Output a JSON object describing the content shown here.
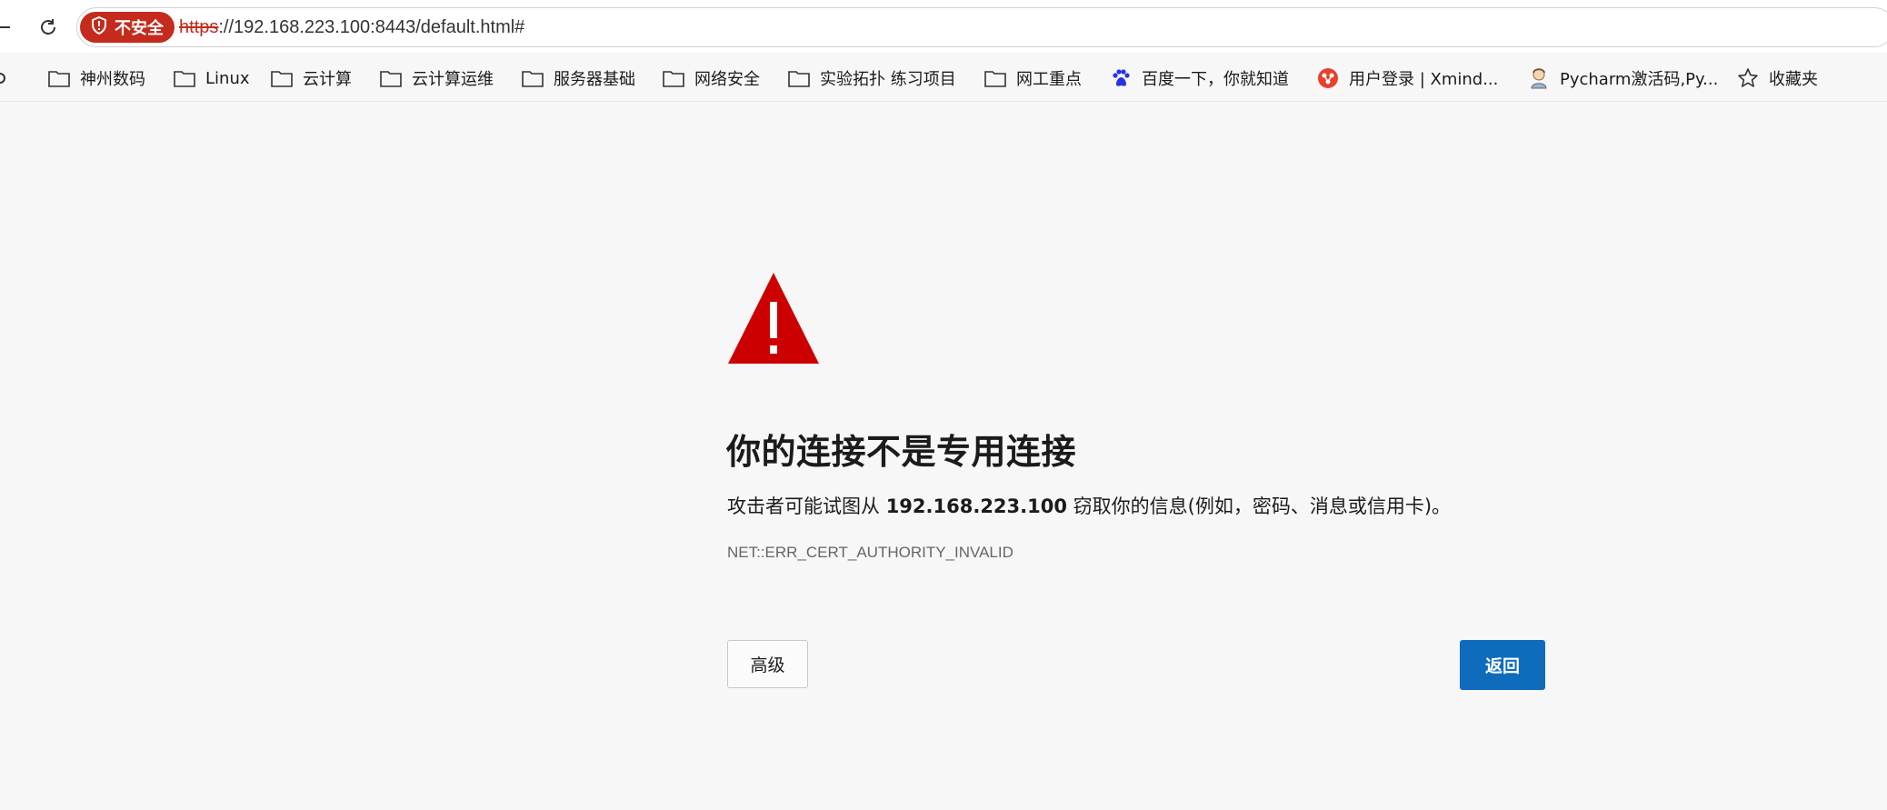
{
  "browser": {
    "security_chip": "不安全",
    "url_scheme": "https",
    "url_rest": "://192.168.223.100:8443/default.html#"
  },
  "bookmarks": [
    {
      "label": "神州数码",
      "icon": "folder-icon"
    },
    {
      "label": "Linux",
      "icon": "folder-icon"
    },
    {
      "label": "云计算",
      "icon": "folder-icon"
    },
    {
      "label": "云计算运维",
      "icon": "folder-icon"
    },
    {
      "label": "服务器基础",
      "icon": "folder-icon"
    },
    {
      "label": "网络安全",
      "icon": "folder-icon"
    },
    {
      "label": "实验拓扑 练习项目",
      "icon": "folder-icon"
    },
    {
      "label": "网工重点",
      "icon": "folder-icon"
    },
    {
      "label": "百度一下，你就知道",
      "icon": "baidu-paw-icon"
    },
    {
      "label": "用户登录 | Xmind...",
      "icon": "xmind-icon"
    },
    {
      "label": "Pycharm激活码,Py...",
      "icon": "avatar-icon"
    },
    {
      "label": "收藏夹",
      "icon": "star-icon"
    }
  ],
  "error_page": {
    "title": "你的连接不是专用连接",
    "desc_before": "攻击者可能试图从 ",
    "desc_host": "192.168.223.100",
    "desc_after": " 窃取你的信息(例如，密码、消息或信用卡)。",
    "error_code": "NET::ERR_CERT_AUTHORITY_INVALID",
    "advanced_label": "高级",
    "back_label": "返回"
  },
  "colors": {
    "warning_red": "#cc0000",
    "primary_blue": "#0f6cbd",
    "insecure_red": "#c42b1c"
  }
}
